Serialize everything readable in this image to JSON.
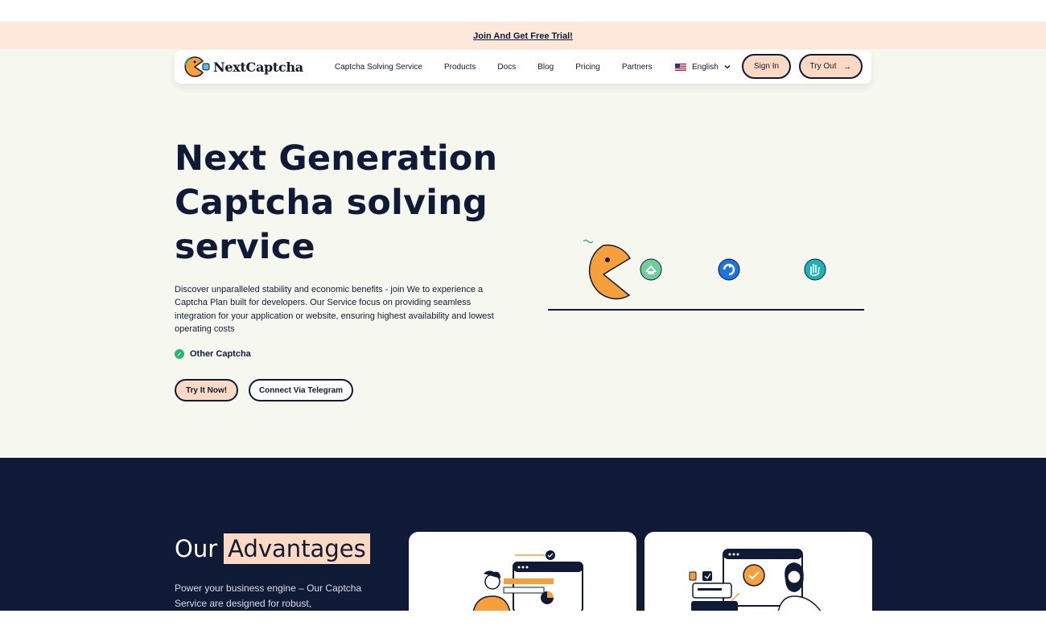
{
  "promo": {
    "text": "Join And Get Free Trial!"
  },
  "nav": {
    "logo_text": "NextCaptcha",
    "links": [
      "Captcha Solving Service",
      "Products",
      "Docs",
      "Blog",
      "Pricing",
      "Partners"
    ],
    "language": "English",
    "sign_in": "Sign In",
    "try_out": "Try Out",
    "try_out_arrow": "→"
  },
  "hero": {
    "title": "Next Generation Captcha solving service",
    "description": "Discover unparalleled stability and economic benefits - join We to experience a Captcha Plan built for developers. Our Service focus on providing seamless integration for your application or website, ensuring highest availability and lowest operating costs",
    "feature": "Other Captcha",
    "feature_check": "✓",
    "btn_try": "Try It Now!",
    "btn_telegram": "Connect Via Telegram"
  },
  "advantages": {
    "title_plain": "Our",
    "title_highlight": "Advantages",
    "description": "Power your business engine – Our Captcha Service are designed for robust,"
  },
  "colors": {
    "navy": "#0f1a36",
    "peach": "#fcd9c2",
    "promo_bg": "#fde8da",
    "hero_bg": "#f6f8f0",
    "pacman_orange": "#f7a03a",
    "check_green": "#2bb673"
  },
  "icons": {
    "pacman": "pacman-icon",
    "captcha_a": "hcaptcha-icon",
    "captcha_b": "recaptcha-icon",
    "captcha_c": "hand-captcha-icon"
  }
}
